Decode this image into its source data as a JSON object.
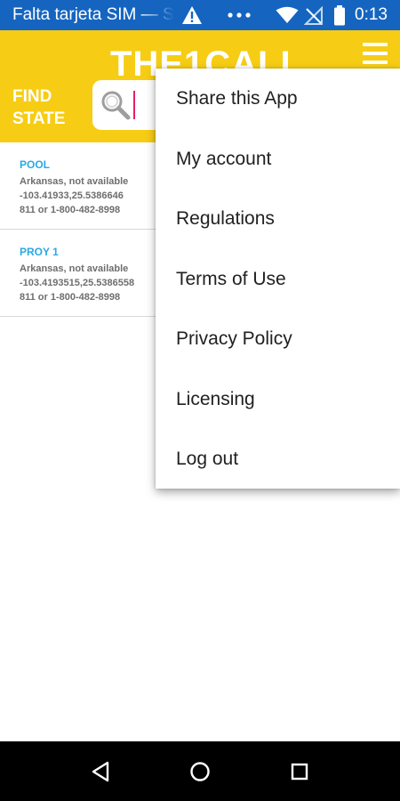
{
  "status_bar": {
    "notification_text": "Falta tarjeta SIM — S",
    "time": "0:13",
    "icons": [
      "warning-icon",
      "more-dots-icon",
      "wifi-icon",
      "no-signal-icon",
      "battery-icon"
    ]
  },
  "header": {
    "title": "THE1CALL",
    "find_state_line1": "FIND",
    "find_state_line2": "STATE",
    "search_value": "",
    "brand_color": "#f6cd14"
  },
  "list": [
    {
      "title": "POOL",
      "location": "Arkansas, not available",
      "coords": "-103.41933,25.5386646",
      "phone": "811 or 1-800-482-8998"
    },
    {
      "title": "PROY 1",
      "location": "Arkansas, not available",
      "coords": "-103.4193515,25.5386558",
      "phone": "811 or 1-800-482-8998"
    }
  ],
  "menu": {
    "items": [
      "Share this App",
      "My account",
      "Regulations",
      "Terms of Use",
      "Privacy Policy",
      "Licensing",
      "Log out"
    ]
  },
  "colors": {
    "status_bar": "#1565c0",
    "accent_title": "#29a9e1",
    "caret": "#e91e63"
  }
}
